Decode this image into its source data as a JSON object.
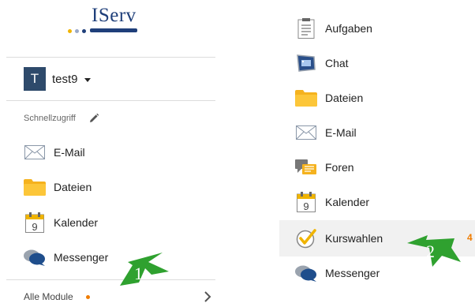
{
  "logo": {
    "text": "IServ"
  },
  "user": {
    "avatar_letter": "T",
    "name": "test9"
  },
  "quick_access": {
    "label": "Schnellzugriff",
    "items": [
      {
        "label": "E-Mail",
        "icon": "envelope-icon"
      },
      {
        "label": "Dateien",
        "icon": "folder-icon"
      },
      {
        "label": "Kalender",
        "icon": "calendar-icon"
      },
      {
        "label": "Messenger",
        "icon": "messenger-icon"
      }
    ]
  },
  "all_modules": {
    "label": "Alle Module"
  },
  "modules": {
    "items": [
      {
        "label": "Aufgaben",
        "icon": "clipboard-icon"
      },
      {
        "label": "Chat",
        "icon": "chat-icon"
      },
      {
        "label": "Dateien",
        "icon": "folder-icon"
      },
      {
        "label": "E-Mail",
        "icon": "envelope-icon"
      },
      {
        "label": "Foren",
        "icon": "forum-icon"
      },
      {
        "label": "Kalender",
        "icon": "calendar-icon"
      },
      {
        "label": "Kurswahlen",
        "icon": "checkmark-icon",
        "badge": "4"
      },
      {
        "label": "Messenger",
        "icon": "messenger-icon"
      }
    ]
  },
  "annotations": {
    "arrow1": "1",
    "arrow2": "2"
  },
  "colors": {
    "brand": "#1f3f7a",
    "accent": "#f07c00",
    "arrow": "#2fa12f",
    "highlight": "#f1f1f1"
  }
}
